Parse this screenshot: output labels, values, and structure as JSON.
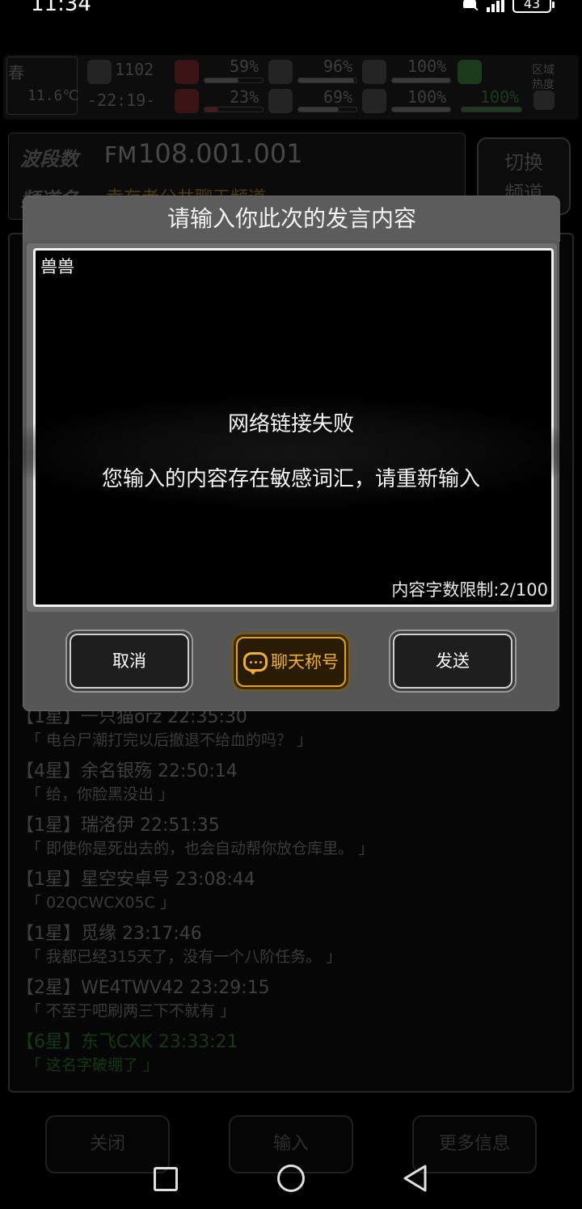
{
  "status_bar": {
    "time": "11:34",
    "battery": "43"
  },
  "hud": {
    "season": "春",
    "temperature": "11.6℃",
    "time_a": "1102",
    "time_b": "-22:19-",
    "health_pct": "59%",
    "health_pct2": "23%",
    "stat_a": "96%",
    "stat_b": "69%",
    "stat_c": "100%",
    "stat_d": "100%",
    "stat_e": "100%",
    "region_label_1": "区域",
    "region_label_2": "热度"
  },
  "frequency": {
    "label": "波段数",
    "fm": "FM",
    "value": "108.001.001",
    "channel_label": "频道名",
    "channel": "幸存者公共聊天频道",
    "switch_label_1": "切换",
    "switch_label_2": "频道"
  },
  "chat": {
    "messages": [
      {
        "head": "【1星】一只猫orz 22:35:30",
        "body": "「 电台尸潮打完以后撤退不给血的吗？ 」",
        "green": false
      },
      {
        "head": "【4星】余名银殇 22:50:14",
        "body": "「 给，你脸黑没出 」",
        "green": false
      },
      {
        "head": "【1星】瑞洛伊 22:51:35",
        "body": "「 即使你是死出去的，也会自动帮你放仓库里。 」",
        "green": false
      },
      {
        "head": "【1星】星空安卓号 23:08:44",
        "body": "「 02QCWCX05C 」",
        "green": false
      },
      {
        "head": "【1星】觅缘 23:17:46",
        "body": "「 我都已经315天了，没有一个八阶任务。 」",
        "green": false
      },
      {
        "head": "【2星】WE4TWV42 23:29:15",
        "body": "「 不至于吧刷两三下不就有 」",
        "green": false
      },
      {
        "head": "【6星】东飞CXK 23:33:21",
        "body": "「 这名字破绷了 」",
        "green": true
      }
    ]
  },
  "bottom_buttons": {
    "close": "关闭",
    "input": "输入",
    "more": "更多信息"
  },
  "dialog": {
    "title": "请输入你此次的发言内容",
    "input_value": "兽兽",
    "char_count": "内容字数限制:2/100",
    "cancel": "取消",
    "nickname": "聊天称号",
    "send": "发送"
  },
  "toast": {
    "title": "网络链接失败",
    "message": "您输入的内容存在敏感词汇，请重新输入"
  }
}
